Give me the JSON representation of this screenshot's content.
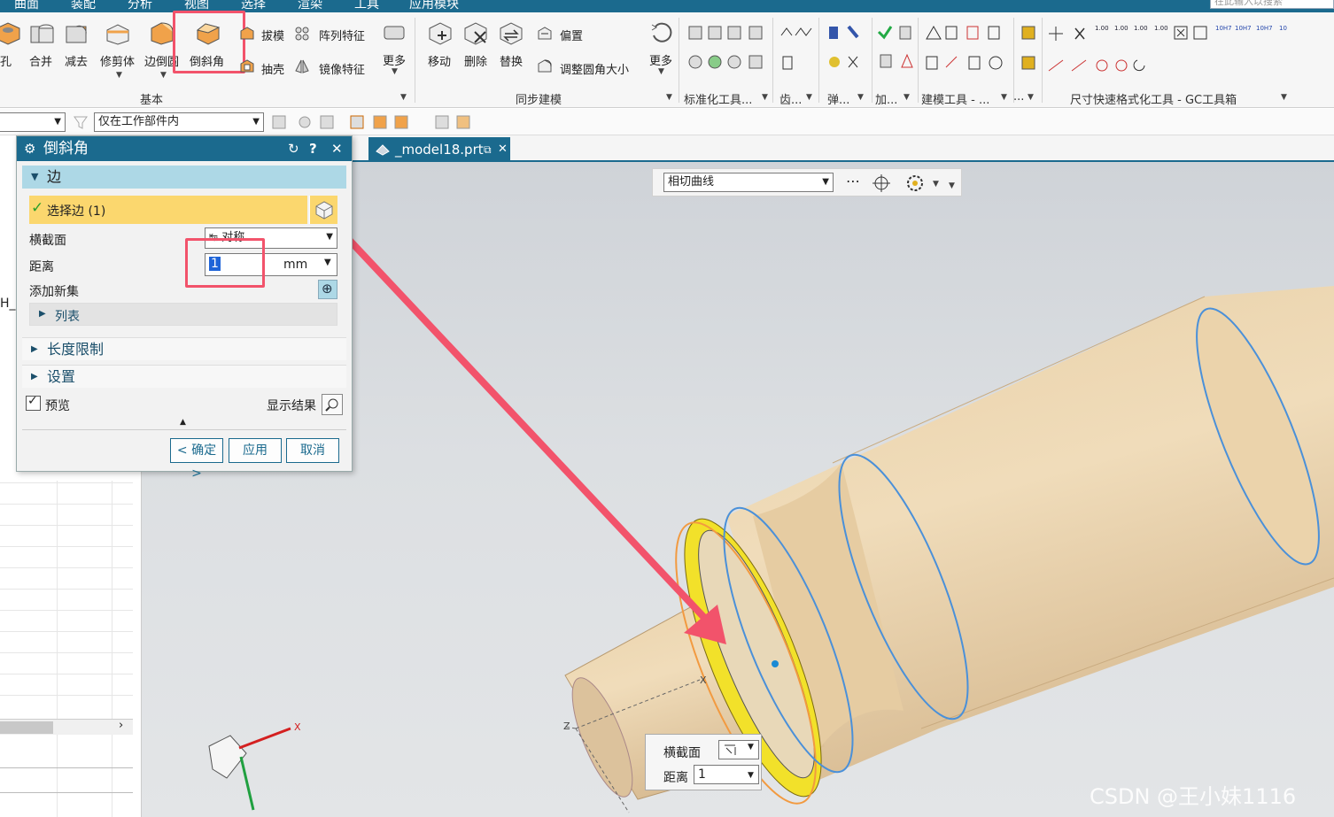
{
  "menubar": {
    "items": [
      "曲面",
      "装配",
      "分析",
      "视图",
      "选择",
      "渲染",
      "工具",
      "应用模块"
    ],
    "search_placeholder": "在此输入以搜索"
  },
  "ribbon": {
    "basic": {
      "group_label": "基本",
      "hole": "孔",
      "unite": "合并",
      "subtract": "减去",
      "trim_body": "修剪体",
      "edge_blend": "边倒圆",
      "chamfer": "倒斜角",
      "draft": "拔模",
      "pattern": "阵列特征",
      "shell": "抽壳",
      "mirror": "镜像特征",
      "more": "更多"
    },
    "sync": {
      "group_label": "同步建模",
      "move": "移动",
      "delete": "删除",
      "replace": "替换",
      "offset": "偏置",
      "resize_blend": "调整圆角大小",
      "more": "更多"
    },
    "other_groups": [
      "标准化工具...",
      "齿...",
      "弹...",
      "加...",
      "建模工具 - ...",
      "...",
      "尺寸快速格式化工具 - GC工具箱"
    ],
    "gc_labels": [
      "1.00",
      "1.00",
      "1.00",
      "1.00",
      "10H7",
      "10H7",
      "10H7",
      "10"
    ]
  },
  "toolbar2": {
    "filter_value": "",
    "scope_value": "仅在工作部件内"
  },
  "navigator": {
    "partial_label": "H_"
  },
  "dialog": {
    "title": "倒斜角",
    "edge_section": "边",
    "select_edge": "选择边 (1)",
    "cross_section_label": "横截面",
    "cross_section_value": "对称",
    "distance_label": "距离",
    "distance_value": "1",
    "distance_unit": "mm",
    "add_new_set": "添加新集",
    "list": "列表",
    "length_limit": "长度限制",
    "settings": "设置",
    "preview": "预览",
    "preview_checked": true,
    "show_result": "显示结果",
    "ok": "< 确定 >",
    "apply": "应用",
    "cancel": "取消"
  },
  "graphics": {
    "file_tab": "_model18.prt",
    "snap_combo": "相切曲线",
    "float_cross_section": "横截面",
    "float_distance_label": "距离",
    "float_distance_value": "1",
    "axis_x": "X",
    "axis_z": "Z",
    "watermark": "CSDN @王小妹1116"
  },
  "colors": {
    "title_bar": "#1b6a8e",
    "highlight": "#f2536b",
    "part_body": "#f4d7aa",
    "edge_blue": "#4a90d9",
    "chamfer_yellow": "#f2e12a"
  }
}
